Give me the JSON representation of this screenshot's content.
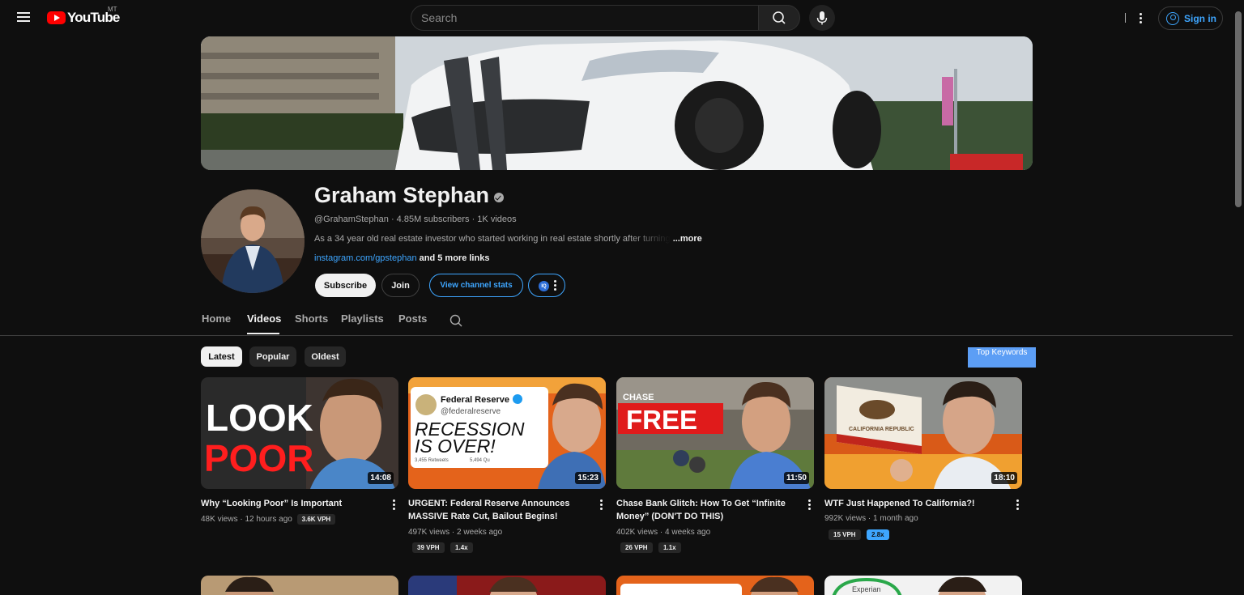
{
  "header": {
    "logo_text": "YouTube",
    "region": "MT",
    "search_placeholder": "Search",
    "signin_label": "Sign in"
  },
  "channel": {
    "name": "Graham Stephan",
    "handle": "@GrahamStephan",
    "subscribers": "4.85M subscribers",
    "video_count": "1K videos",
    "meta_line": "@GrahamStephan · 4.85M subscribers · 1K videos",
    "description": "As a 34 year old real estate investor who started working in real estate shortly after turning",
    "more_label": "...more",
    "link": "instagram.com/gpstephan",
    "more_links": " and 5 more links",
    "subscribe_label": "Subscribe",
    "join_label": "Join",
    "stats_label": "View channel stats",
    "ext_label": "IQ"
  },
  "tabs": [
    "Home",
    "Videos",
    "Shorts",
    "Playlists",
    "Posts"
  ],
  "active_tab": "Videos",
  "filters": [
    "Latest",
    "Popular",
    "Oldest"
  ],
  "active_filter": "Latest",
  "top_keywords_label": "Top Keywords",
  "videos": [
    {
      "title": "Why “Looking Poor” Is Important",
      "views": "48K views",
      "age": "12 hours ago",
      "duration": "14:08",
      "badges": [
        "3.6K VPH"
      ],
      "thumb_text": [
        "LOOK",
        "POOR"
      ]
    },
    {
      "title": "URGENT: Federal Reserve Announces MASSIVE Rate Cut, Bailout Begins!",
      "views": "497K views",
      "age": "2 weeks ago",
      "duration": "15:23",
      "badges": [
        "39 VPH",
        "1.4x"
      ],
      "thumb_text": [
        "Federal Reserve",
        "@federalreserve",
        "RECESSION",
        "IS OVER!",
        "3,455 Retweets",
        "5,494 Qu"
      ]
    },
    {
      "title": "Chase Bank Glitch: How To Get “Infinite Money” (DON'T DO THIS)",
      "views": "402K views",
      "age": "4 weeks ago",
      "duration": "11:50",
      "badges": [
        "26 VPH",
        "1.1x"
      ],
      "thumb_text": [
        "CHASE",
        "FREE"
      ]
    },
    {
      "title": "WTF Just Happened To California?!",
      "views": "992K views",
      "age": "1 month ago",
      "duration": "18:10",
      "badges": [
        "15 VPH",
        "2.8x"
      ],
      "thumb_text": [
        "CALIFORNIA REPUBLIC"
      ]
    }
  ],
  "bottom_row_thumb_text": [
    "Experian"
  ],
  "colors": {
    "background": "#0f0f0f",
    "accent_blue": "#3ea6ff",
    "youtube_red": "#ff0000",
    "keywords_button": "#5c9ef5"
  },
  "icons": [
    "menu-icon",
    "youtube-logo-icon",
    "search-icon",
    "mic-icon",
    "more-vert-icon",
    "user-circle-icon",
    "verified-icon"
  ]
}
